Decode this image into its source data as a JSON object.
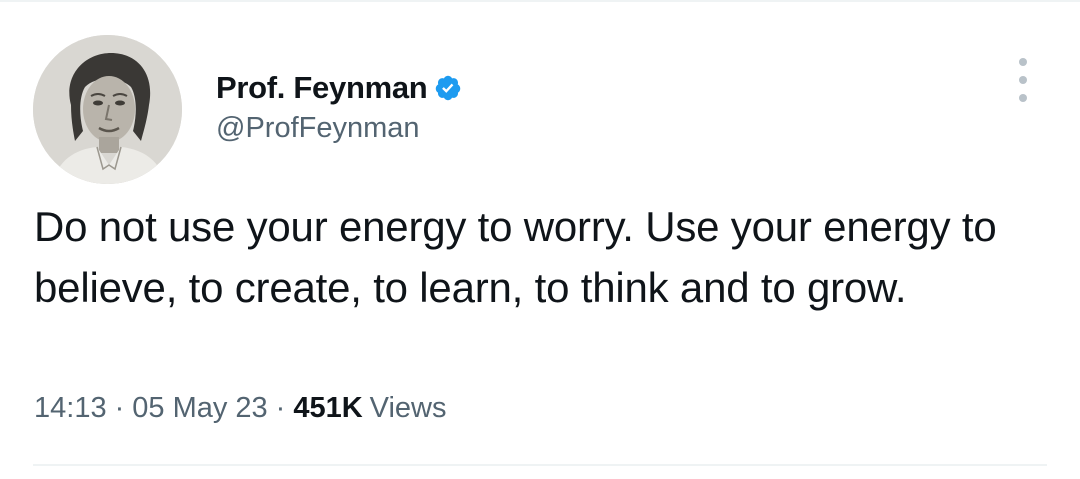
{
  "tweet": {
    "author": {
      "display_name": "Prof. Feynman",
      "handle": "@ProfFeynman",
      "verified": true,
      "avatar_icon": "portrait-avatar"
    },
    "text": "Do not use your energy to worry. Use your energy to believe, to create, to learn, to think and to grow.",
    "time": "14:13",
    "date": "05 May 23",
    "separator": "·",
    "views_count": "451K",
    "views_label": "Views",
    "more_icon": "more-vertical-icon"
  },
  "colors": {
    "text_primary": "#0f1419",
    "text_secondary": "#536471",
    "verified_blue": "#1d9bf0",
    "divider": "#eff3f4"
  }
}
